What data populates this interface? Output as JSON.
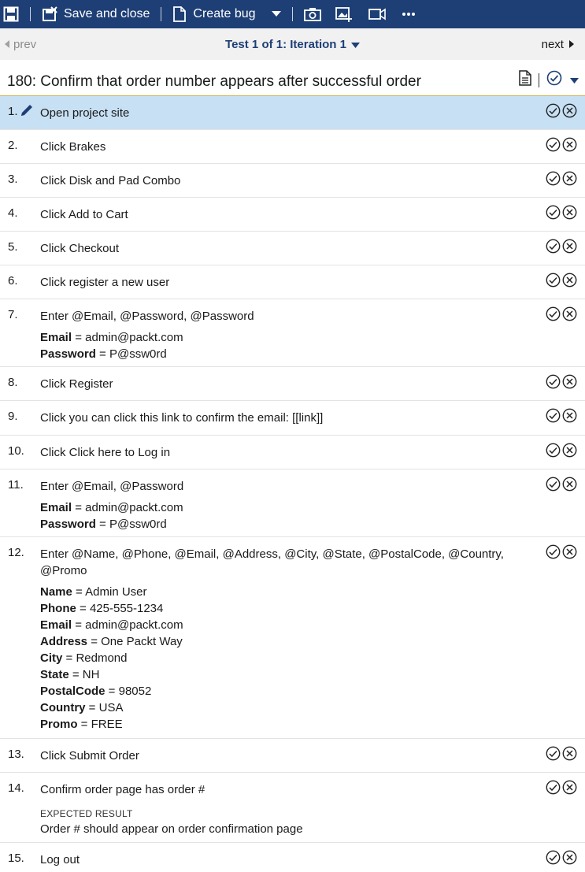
{
  "toolbar": {
    "save_close_label": "Save and close",
    "create_bug_label": "Create bug",
    "icons": [
      "save-icon",
      "save-close-icon",
      "create-bug-icon",
      "dropdown-caret-icon",
      "screenshot-icon",
      "capture-image-icon",
      "record-video-icon",
      "more-icon"
    ]
  },
  "nav": {
    "prev_label": "prev",
    "next_label": "next",
    "iteration_label": "Test 1 of 1: Iteration 1"
  },
  "test_case": {
    "title": "180: Confirm that order number appears after successful order"
  },
  "colors": {
    "toolbar_bg": "#1e3f75",
    "active_row_bg": "#c7e0f4",
    "nav_bg": "#f1f1f1",
    "accent_text": "#1e3f75"
  },
  "steps": [
    {
      "number": "1.",
      "text": "Open project site",
      "active": true
    },
    {
      "number": "2.",
      "text": "Click Brakes"
    },
    {
      "number": "3.",
      "text": "Click Disk and Pad Combo"
    },
    {
      "number": "4.",
      "text": "Click Add to Cart"
    },
    {
      "number": "5.",
      "text": "Click Checkout"
    },
    {
      "number": "6.",
      "text": "Click register a new user"
    },
    {
      "number": "7.",
      "text": "Enter @Email, @Password, @Password",
      "params": [
        {
          "name": "Email",
          "value": "admin@packt.com"
        },
        {
          "name": "Password",
          "value": "P@ssw0rd"
        }
      ]
    },
    {
      "number": "8.",
      "text": "Click Register"
    },
    {
      "number": "9.",
      "text": "Click you can click this link to confirm the email: [[link]]"
    },
    {
      "number": "10.",
      "text": "Click Click here to Log in"
    },
    {
      "number": "11.",
      "text": "Enter @Email, @Password",
      "params": [
        {
          "name": "Email",
          "value": "admin@packt.com"
        },
        {
          "name": "Password",
          "value": "P@ssw0rd"
        }
      ]
    },
    {
      "number": "12.",
      "text": "Enter @Name, @Phone, @Email, @Address, @City, @State, @PostalCode, @Country, @Promo",
      "params": [
        {
          "name": "Name",
          "value": "Admin User"
        },
        {
          "name": "Phone",
          "value": "425-555-1234"
        },
        {
          "name": "Email",
          "value": "admin@packt.com"
        },
        {
          "name": "Address",
          "value": "One Packt Way"
        },
        {
          "name": "City",
          "value": "Redmond"
        },
        {
          "name": "State",
          "value": "NH"
        },
        {
          "name": "PostalCode",
          "value": "98052"
        },
        {
          "name": "Country",
          "value": "USA"
        },
        {
          "name": "Promo",
          "value": "FREE"
        }
      ]
    },
    {
      "number": "13.",
      "text": "Click Submit Order"
    },
    {
      "number": "14.",
      "text": "Confirm order page has order #",
      "expected_label": "EXPECTED RESULT",
      "expected": "Order # should appear on order confirmation page"
    },
    {
      "number": "15.",
      "text": "Log out"
    }
  ]
}
